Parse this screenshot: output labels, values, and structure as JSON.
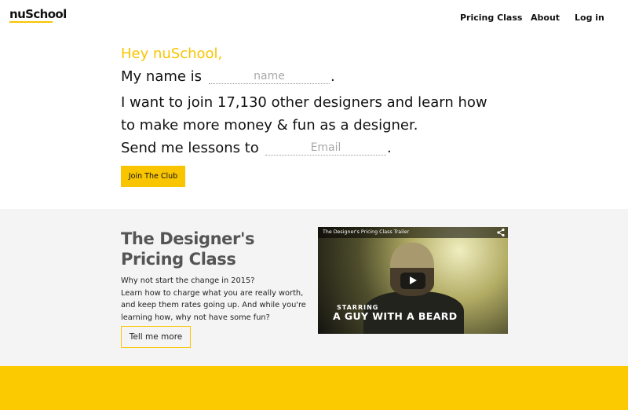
{
  "header": {
    "logo": "nuSchool",
    "nav": [
      {
        "label": "Pricing Class"
      },
      {
        "label": "About"
      },
      {
        "label": "Log in"
      }
    ]
  },
  "signup": {
    "greeting": "Hey nuSchool,",
    "name_prefix": "My name is",
    "name_placeholder": "name",
    "line2": "I want to join 17,130 other designers and learn how",
    "line3": "to make more money & fun as a designer.",
    "email_prefix": "Send me lessons to",
    "email_placeholder": "Email",
    "period": ".",
    "join_button": "Join The Club"
  },
  "course": {
    "title_line1": "The Designer's",
    "title_line2": "Pricing Class",
    "desc_lines": [
      "Why not start the change in 2015?",
      "Learn how to charge what you are really worth,",
      "and keep them rates going up. And while you're",
      "learning how, why not have some fun?"
    ],
    "cta_button": "Tell me more"
  },
  "video": {
    "title": "The Designer's Pricing Class Trailer",
    "overlay_small": "STARRING",
    "overlay_large": "A GUY WITH A BEARD",
    "icons": [
      "share-icon",
      "play-icon"
    ]
  },
  "colors": {
    "accent": "#f8c500",
    "footer_band": "#fcca00",
    "section_bg": "#f4f4f4",
    "title_gray": "#555555"
  }
}
